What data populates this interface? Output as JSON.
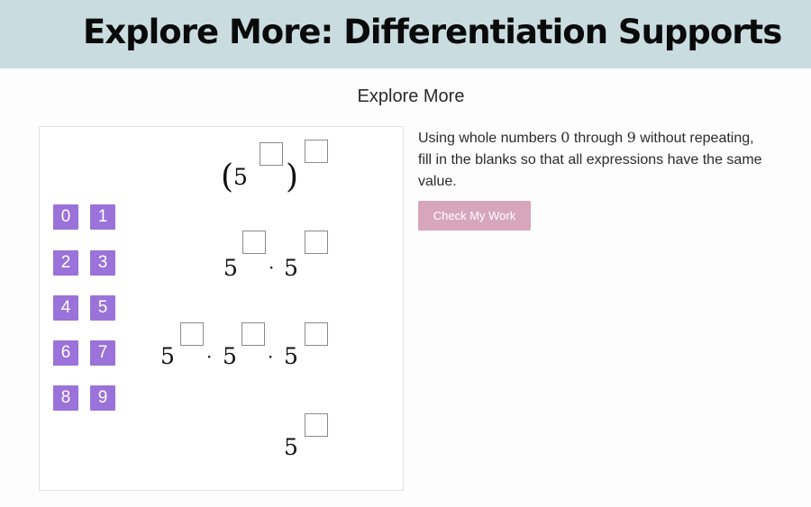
{
  "banner": {
    "title": "Explore More:  Differentiation Supports"
  },
  "section": {
    "title": "Explore More"
  },
  "tiles": [
    "0",
    "1",
    "2",
    "3",
    "4",
    "5",
    "6",
    "7",
    "8",
    "9"
  ],
  "expressions": {
    "base": "5",
    "open_paren": "(",
    "close_paren": ")",
    "dot": "·"
  },
  "instructions": {
    "part1": "Using whole numbers ",
    "num_a": "0",
    "part2": " through ",
    "num_b": "9",
    "part3": " without repeating, fill in the blanks so that all expressions have the same value."
  },
  "check_button": {
    "label": "Check My Work"
  },
  "colors": {
    "banner": "#c9dde0",
    "tile": "#9a72d9",
    "check_button": "#d7a6bd"
  }
}
